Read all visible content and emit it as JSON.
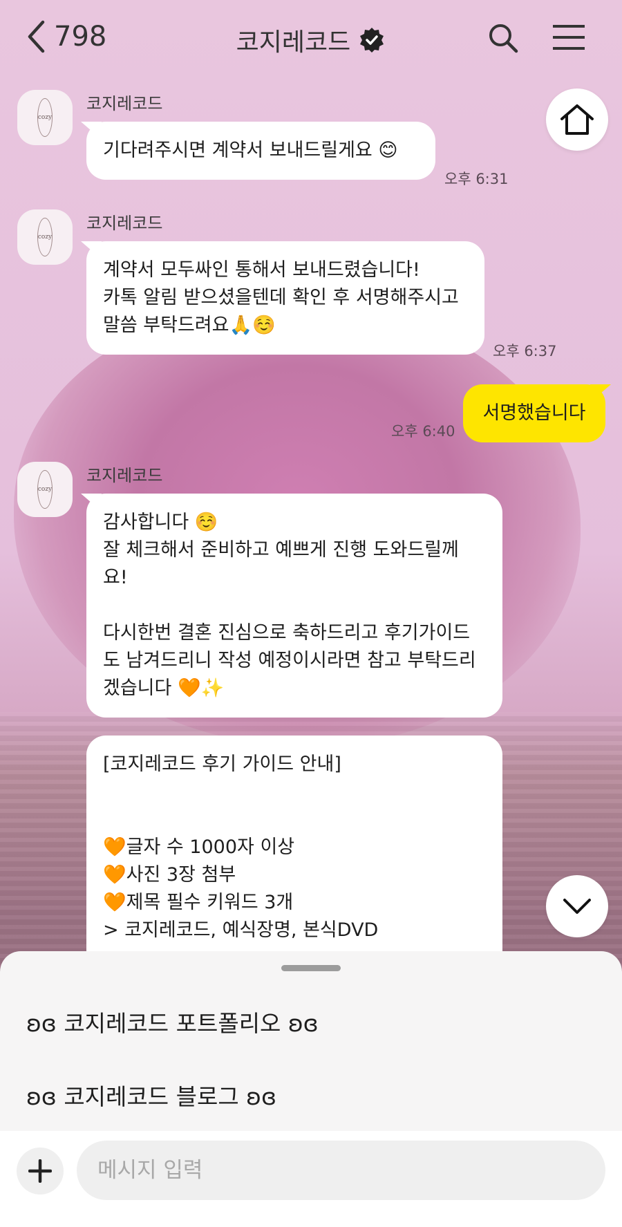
{
  "header": {
    "back_count": "798",
    "title": "코지레코드",
    "icons": {
      "back": "chevron-left-icon",
      "verified": "verified-badge-icon",
      "search": "search-icon",
      "menu": "menu-icon"
    }
  },
  "messages": [
    {
      "sender": "코지레코드",
      "text": "기다려주시면 계약서 보내드릴게요  😊",
      "time": "오후 6:31"
    },
    {
      "sender": "코지레코드",
      "text": "계약서 모두싸인 통해서 보내드렸습니다!\n카톡 알림 받으셨을텐데 확인 후 서명해주시고\n말씀 부탁드려요🙏☺️",
      "time": "오후 6:37"
    },
    {
      "sender": "me",
      "text": "서명했습니다",
      "time": "오후 6:40"
    },
    {
      "sender": "코지레코드",
      "text": "감사합니다 ☺️\n잘 체크해서 준비하고 예쁘게 진행 도와드릴께\n요!\n\n다시한번 결혼 진심으로 축하드리고 후기가이드\n도 남겨드리니 작성 예정이시라면 참고 부탁드리\n겠습니다 🧡✨"
    },
    {
      "sender": "코지레코드",
      "text": "[코지레코드 후기 가이드 안내]\n\n\n🧡글자 수 1000자 이상\n🧡사진 3장 첨부\n🧡제목 필수 키워드 3개\n> 코지레코드, 예식장명, 본식DVD"
    }
  ],
  "avatar": {
    "logo_text": "cozy"
  },
  "floating": {
    "home": "home-icon",
    "scroll_down": "chevron-down-icon"
  },
  "sheet": {
    "links": [
      "ʚɞ 코지레코드 포트폴리오 ʚɞ",
      "ʚɞ 코지레코드 블로그 ʚɞ"
    ]
  },
  "input": {
    "placeholder": "메시지 입력",
    "plus_icon": "plus-icon"
  },
  "colors": {
    "my_bubble": "#fee500",
    "their_bubble": "#ffffff",
    "background": "#e5bfdc"
  }
}
